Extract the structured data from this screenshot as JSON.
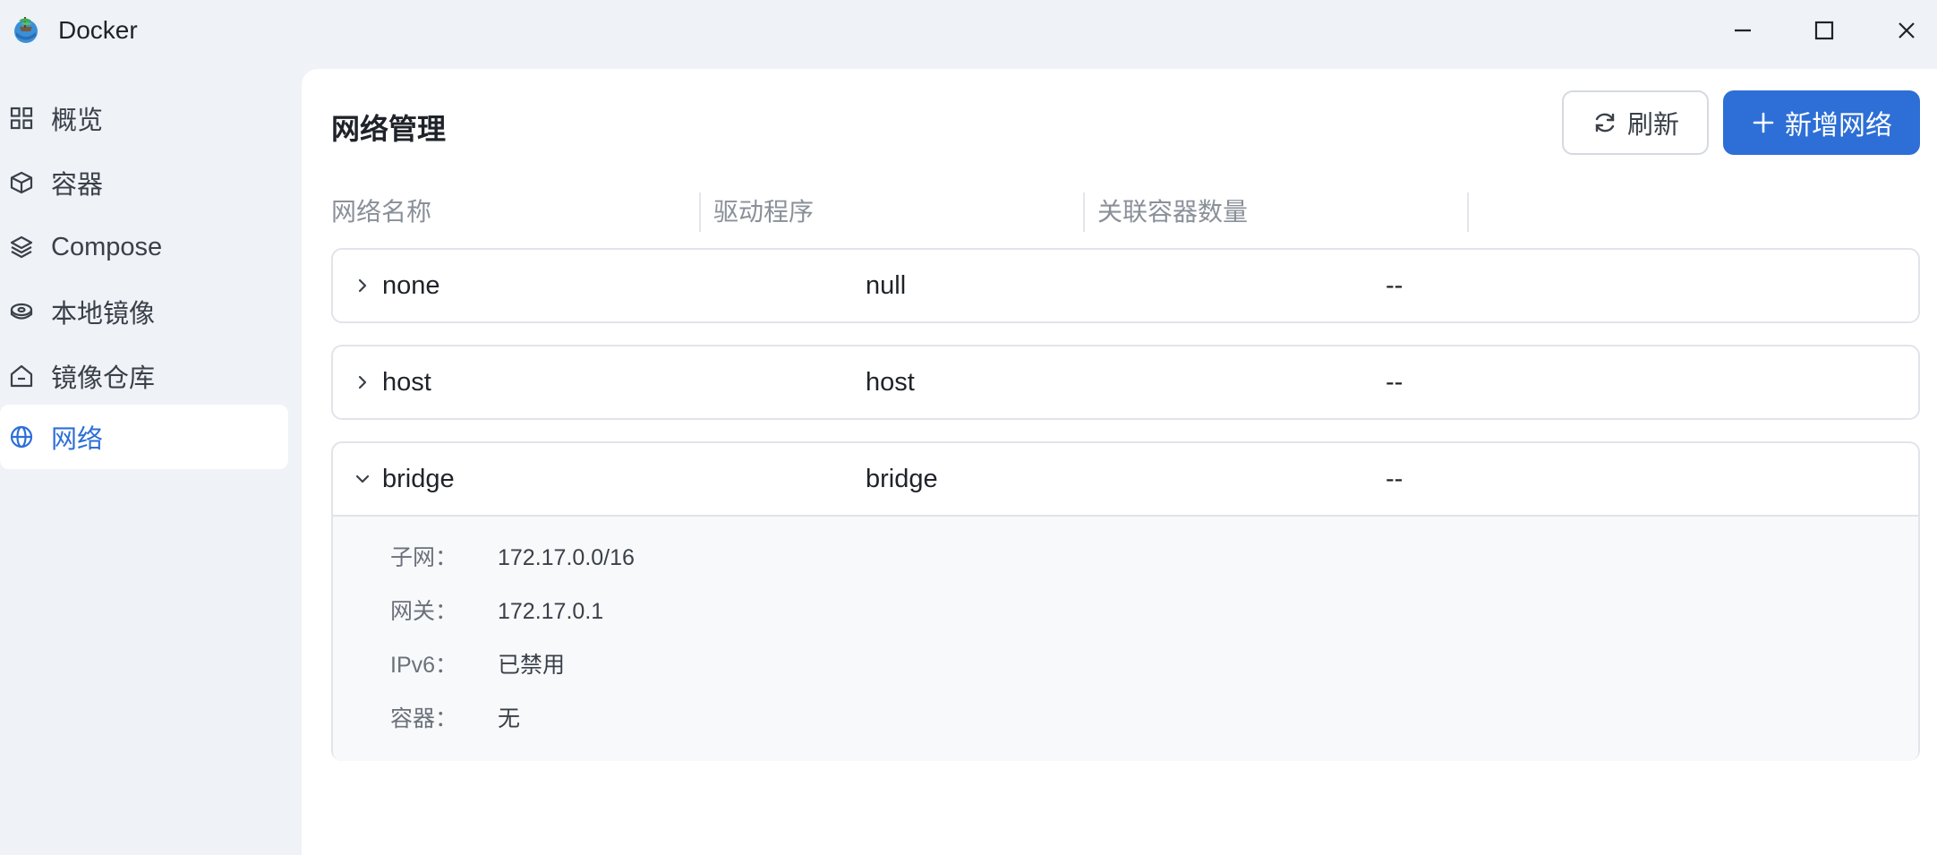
{
  "window": {
    "title": "Docker"
  },
  "sidebar": {
    "items": [
      {
        "label": "概览",
        "icon": "grid-icon",
        "active": false
      },
      {
        "label": "容器",
        "icon": "cube-icon",
        "active": false
      },
      {
        "label": "Compose",
        "icon": "layers-icon",
        "active": false
      },
      {
        "label": "本地镜像",
        "icon": "disk-icon",
        "active": false
      },
      {
        "label": "镜像仓库",
        "icon": "house-icon",
        "active": false
      },
      {
        "label": "网络",
        "icon": "globe-icon",
        "active": true
      }
    ]
  },
  "main": {
    "title": "网络管理",
    "refresh_label": "刷新",
    "add_label": "新增网络",
    "columns": [
      "网络名称",
      "驱动程序",
      "关联容器数量"
    ],
    "networks": [
      {
        "name": "none",
        "driver": "null",
        "containers": "--",
        "expanded": false
      },
      {
        "name": "host",
        "driver": "host",
        "containers": "--",
        "expanded": false
      },
      {
        "name": "bridge",
        "driver": "bridge",
        "containers": "--",
        "expanded": true,
        "details": [
          {
            "label": "子网：",
            "value": "172.17.0.0/16"
          },
          {
            "label": "网关：",
            "value": "172.17.0.1"
          },
          {
            "label": "IPv6：",
            "value": "已禁用"
          },
          {
            "label": "容器：",
            "value": "无"
          }
        ]
      }
    ]
  },
  "colors": {
    "accent": "#2d6fd6",
    "background": "#eff2f7",
    "panel": "#ffffff"
  }
}
